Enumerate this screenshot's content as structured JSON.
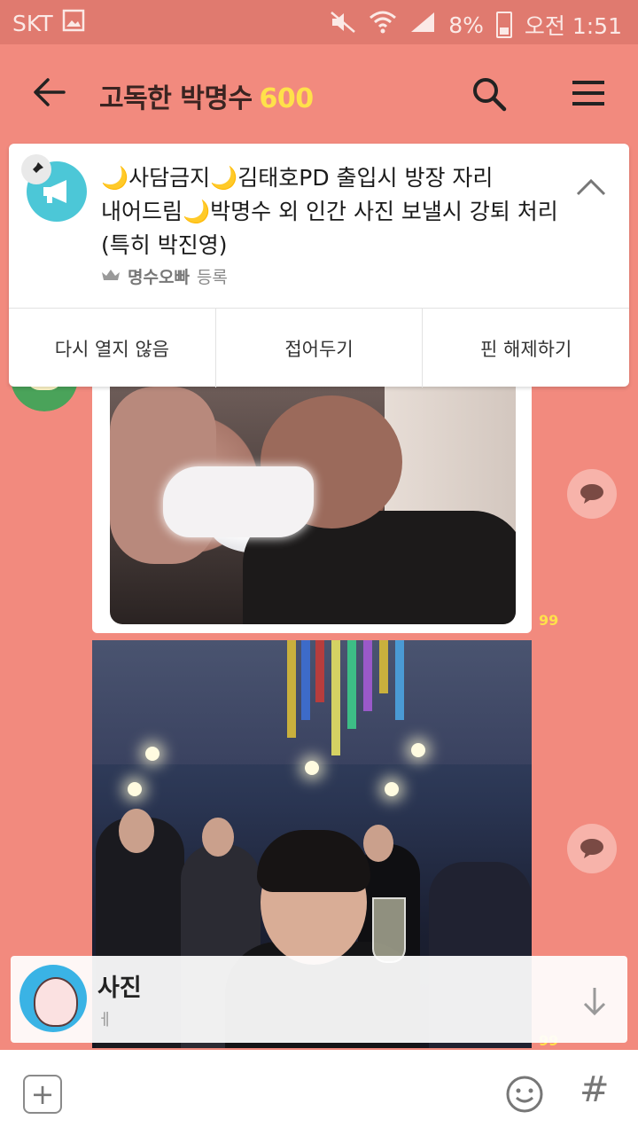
{
  "status_bar": {
    "carrier": "SKT",
    "battery": "8%",
    "time": "오전 1:51"
  },
  "header": {
    "title": "고독한 박명수",
    "member_count": "600"
  },
  "notice": {
    "lines": [
      "🌙사담금지🌙김태호PD 출입시 방장 자리",
      "내어드림🌙박명수 외 인간 사진 보낼시 강퇴 처리",
      "(특히 박진영)"
    ],
    "author": "명수오빠",
    "author_suffix": "등록",
    "actions": [
      "다시 열지 않음",
      "접어두기",
      "핀 해제하기"
    ]
  },
  "messages": [
    {
      "type": "photo",
      "read_count": "99"
    },
    {
      "type": "photo",
      "read_count": "99"
    }
  ],
  "new_message_preview": {
    "sender": "사진",
    "text": "ㅔ"
  },
  "colors": {
    "background": "#f28a7e",
    "status_bar": "#e07a6f",
    "accent_yellow": "#ffe14a"
  }
}
